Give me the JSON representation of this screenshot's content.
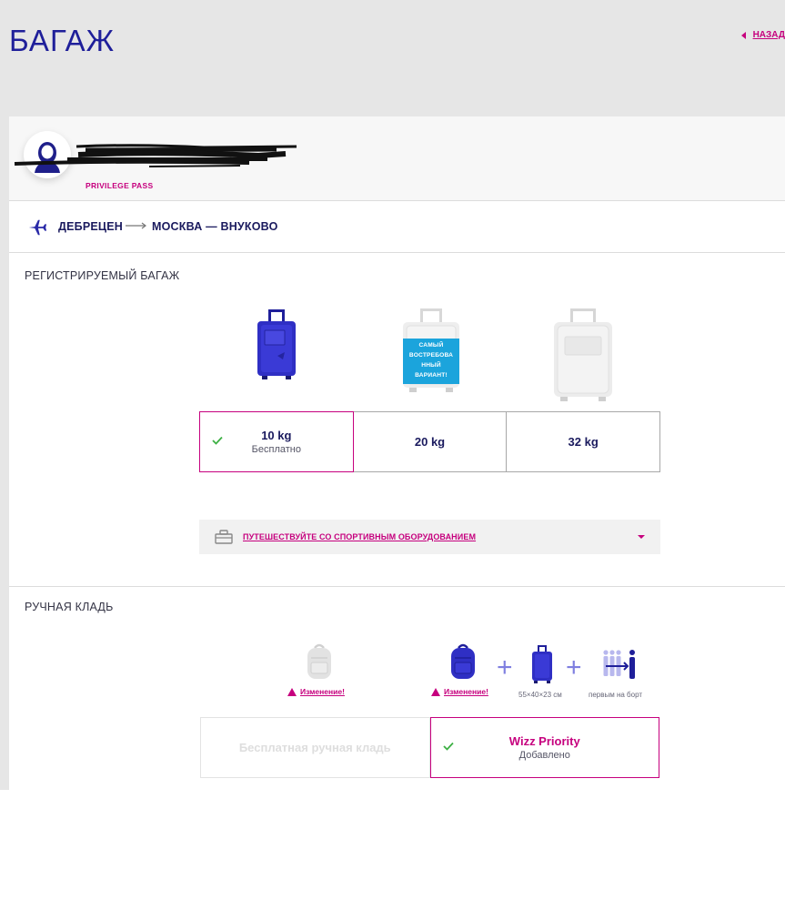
{
  "header": {
    "title": "БАГАЖ",
    "back_label": "НАЗАД"
  },
  "passenger": {
    "pass_type": "PRIVILEGE PASS"
  },
  "route": {
    "from": "ДЕБРЕЦЕН",
    "to": "МОСКВА — ВНУКОВО"
  },
  "checked_baggage": {
    "title": "РЕГИСТРИРУЕМЫЙ БАГАЖ",
    "badge_lines": [
      "САМЫЙ",
      "ВОСТРЕБОВА",
      "ННЫЙ",
      "ВАРИАНТ!"
    ],
    "options": [
      {
        "weight": "10 kg",
        "sub": "Бесплатно",
        "selected": true
      },
      {
        "weight": "20 kg",
        "sub": "",
        "selected": false
      },
      {
        "weight": "32 kg",
        "sub": "",
        "selected": false
      }
    ],
    "sports_label": "ПУТЕШЕСТВУЙТЕ СО СПОРТИВНЫМ ОБОРУДОВАНИЕМ"
  },
  "hand_baggage": {
    "title": "РУЧНАЯ КЛАДЬ",
    "warning_label": "Изменение!",
    "trolley_size": "55×40×23 см",
    "priority_boarding": "первым на борт",
    "free_option": {
      "label": "Бесплатная ручная кладь"
    },
    "priority_option": {
      "label": "Wizz Priority",
      "sub": "Добавлено",
      "selected": true
    }
  },
  "colors": {
    "brand_purple": "#1f1f9a",
    "accent_magenta": "#c6007e",
    "badge_blue": "#1ba4dc",
    "check_green": "#3cb043"
  }
}
